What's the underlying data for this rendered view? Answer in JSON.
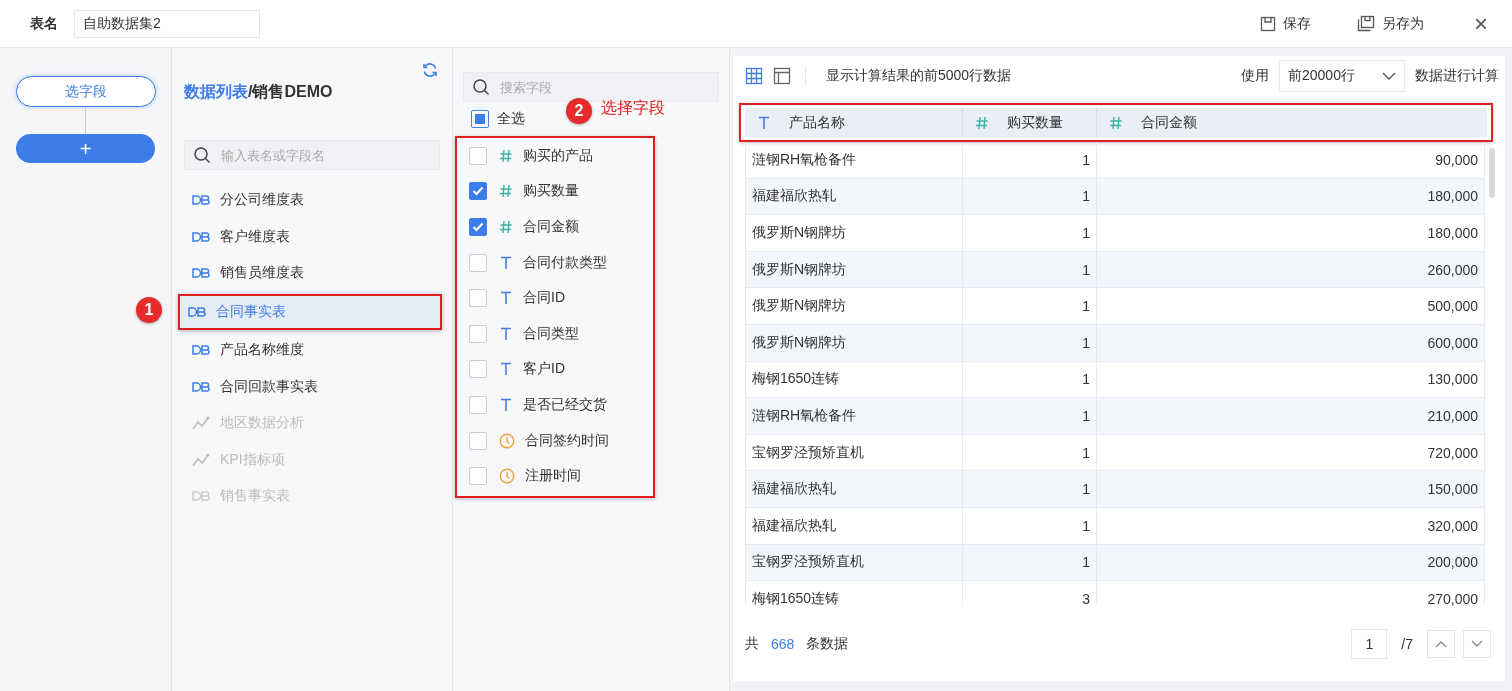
{
  "header": {
    "name_label": "表名",
    "name_value": "自助数据集2",
    "buttons": [
      {
        "kind": "save",
        "label": "保存"
      },
      {
        "kind": "save_as",
        "label": "另存为"
      }
    ],
    "close": "×"
  },
  "steps": {
    "current": "选字段",
    "add": "+"
  },
  "tables": {
    "breadcrumb_link": "数据列表",
    "breadcrumb_rest": "/销售DEMO",
    "search_placeholder": "输入表名或字段名",
    "step_badge": "1",
    "items": [
      {
        "label": "分公司维度表",
        "kind": "db",
        "disabled": false,
        "selected": false
      },
      {
        "label": "客户维度表",
        "kind": "db",
        "disabled": false,
        "selected": false
      },
      {
        "label": "销售员维度表",
        "kind": "db",
        "disabled": false,
        "selected": false
      },
      {
        "label": "合同事实表",
        "kind": "db",
        "disabled": false,
        "selected": true
      },
      {
        "label": "产品名称维度",
        "kind": "db",
        "disabled": false,
        "selected": false
      },
      {
        "label": "合同回款事实表",
        "kind": "db",
        "disabled": false,
        "selected": false
      },
      {
        "label": "地区数据分析",
        "kind": "analysis",
        "disabled": true,
        "selected": false
      },
      {
        "label": "KPI指标项",
        "kind": "analysis",
        "disabled": true,
        "selected": false
      },
      {
        "label": "销售事实表",
        "kind": "db",
        "disabled": true,
        "selected": false
      }
    ]
  },
  "fields": {
    "search_placeholder": "搜索字段",
    "select_all": {
      "label": "全选",
      "checked": false,
      "indeterminate": true
    },
    "step_badge": "2",
    "step_note": "选择字段",
    "items": [
      {
        "label": "购买的产品",
        "kind": "number",
        "checked": false
      },
      {
        "label": "购买数量",
        "kind": "number",
        "checked": true
      },
      {
        "label": "合同金额",
        "kind": "number",
        "checked": true
      },
      {
        "label": "合同付款类型",
        "kind": "text",
        "checked": false
      },
      {
        "label": "合同ID",
        "kind": "text",
        "checked": false
      },
      {
        "label": "合同类型",
        "kind": "text",
        "checked": false
      },
      {
        "label": "客户ID",
        "kind": "text",
        "checked": false
      },
      {
        "label": "是否已经交货",
        "kind": "text",
        "checked": false
      },
      {
        "label": "合同签约时间",
        "kind": "time",
        "checked": false
      },
      {
        "label": "注册时间",
        "kind": "time",
        "checked": false
      }
    ]
  },
  "preview": {
    "views": [
      {
        "kind": "grid",
        "selected": true
      },
      {
        "kind": "panel",
        "selected": false
      }
    ],
    "info": "显示计算结果的前5000行数据",
    "use_label": "使用",
    "rows_option": "前20000行",
    "calc_label": "数据进行计算",
    "columns": [
      {
        "label": "产品名称",
        "kind": "text"
      },
      {
        "label": "购买数量",
        "kind": "number"
      },
      {
        "label": "合同金额",
        "kind": "number"
      }
    ],
    "rows": [
      [
        "涟钢RH氧枪备件",
        "1",
        "90,000"
      ],
      [
        "福建福欣热轧",
        "1",
        "180,000"
      ],
      [
        "俄罗斯N钢牌坊",
        "1",
        "180,000"
      ],
      [
        "俄罗斯N钢牌坊",
        "1",
        "260,000"
      ],
      [
        "俄罗斯N钢牌坊",
        "1",
        "500,000"
      ],
      [
        "俄罗斯N钢牌坊",
        "1",
        "600,000"
      ],
      [
        "梅钢1650连铸",
        "1",
        "130,000"
      ],
      [
        "涟钢RH氧枪备件",
        "1",
        "210,000"
      ],
      [
        "宝钢罗泾预矫直机",
        "1",
        "720,000"
      ],
      [
        "福建福欣热轧",
        "1",
        "150,000"
      ],
      [
        "福建福欣热轧",
        "1",
        "320,000"
      ],
      [
        "宝钢罗泾预矫直机",
        "1",
        "200,000"
      ],
      [
        "梅钢1650连铸",
        "3",
        "270,000"
      ]
    ],
    "total_prefix": "共",
    "total": "668",
    "total_suffix": "条数据",
    "page": "1",
    "pages": "/7"
  }
}
